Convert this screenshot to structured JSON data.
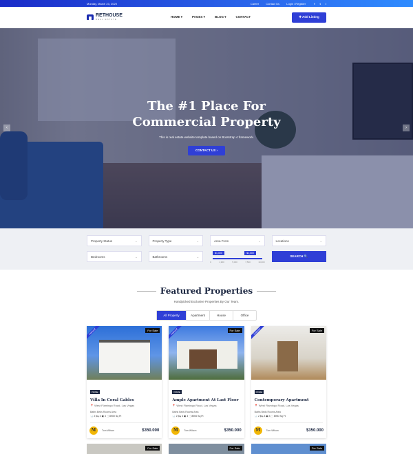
{
  "topbar": {
    "date": "Monday, March 23, 2020",
    "links": [
      "Career",
      "Contact Us",
      "Login / Register"
    ],
    "social": [
      "f",
      "t",
      "i"
    ]
  },
  "nav": {
    "logo": "RETHOUSE",
    "logo_sub": "REAL ESTATE",
    "menu": [
      "HOME ▾",
      "PAGES ▾",
      "BLOG ▾",
      "CONTACT"
    ],
    "add_listing": "✚ Add Listing"
  },
  "hero": {
    "title_line1": "The #1 Place For",
    "title_line2": "Commercial Property",
    "subtitle": "This is real estate website template based on Bootstrap 4 framework.",
    "cta": "CONTACT US  ›",
    "prev": "‹",
    "next": "›"
  },
  "search": {
    "row1": [
      "Property Status",
      "Property Type",
      "Area From",
      "Locations"
    ],
    "row2": [
      "Bedrooms",
      "Bathrooms"
    ],
    "range_min": "$1,000",
    "range_max": "$1,000",
    "ticks": [
      "0",
      "1,900",
      "5,000",
      "7,500",
      "10,000"
    ],
    "button": "SEARCH  🔍"
  },
  "featured": {
    "title": "Featured Properties",
    "subtitle": "Handpicked Exclusive Properties By Our Team.",
    "tabs": [
      "All Property",
      "Apartment",
      "House",
      "Office"
    ]
  },
  "cards": [
    {
      "ribbon": "Featured",
      "status": "For Sale",
      "tag": "PRIME",
      "title": "Villa In Coral Gables",
      "address": "📍 West Flamingo Road, Las Vegas",
      "spec_labels": "Baths   Beds   Rooms   Area",
      "spec_values": "🛁 2   🛏 3   ▣ 3   ⬚ 8900 Sq Ft",
      "agent": "Tom Wilson",
      "price": "$350.000",
      "avatar": "M"
    },
    {
      "ribbon": "Featured",
      "status": "For Sale",
      "tag": "PRIME",
      "title": "Ample Apartment At Last Floor",
      "address": "📍 West Flamingo Road, Las Vegas",
      "spec_labels": "Baths   Beds   Rooms   Area",
      "spec_values": "🛁 2   🛏 3   ▣ 3   ⬚ 8900 Sq Ft",
      "agent": "Tom Wilson",
      "price": "$350.000",
      "avatar": "M"
    },
    {
      "ribbon": "Featured",
      "status": "For Sale",
      "tag": "PRIME",
      "title": "Contemporary Apartment",
      "address": "📍 West Flamingo Road, Las Vegas",
      "spec_labels": "Baths   Beds   Rooms   Area",
      "spec_values": "🛁 2   🛏 3   ▣ 3   ⬚ 8900 Sq Ft",
      "agent": "Tom Wilson",
      "price": "$350.000",
      "avatar": "M"
    }
  ],
  "cards_row2": [
    {
      "status": "For Sale"
    },
    {
      "status": "For Sale"
    },
    {
      "status": "For Sale"
    }
  ]
}
